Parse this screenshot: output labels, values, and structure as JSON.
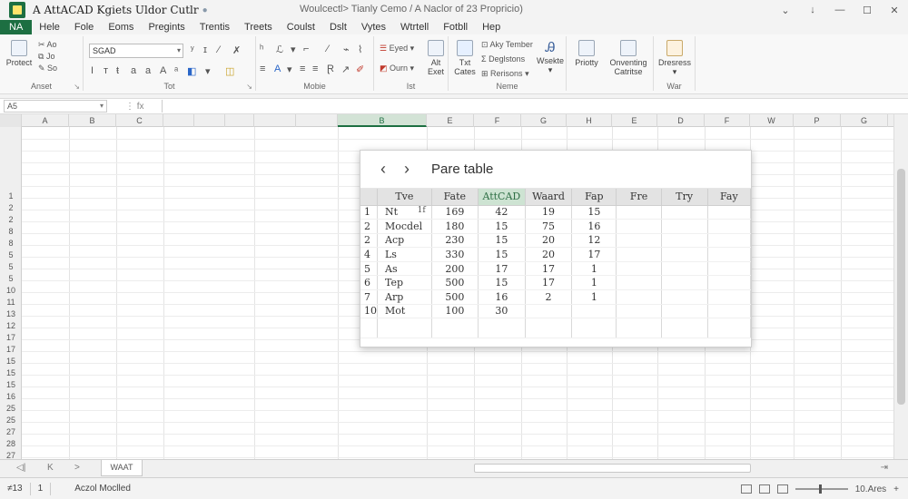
{
  "titlebar": {
    "app_title": "A AttACAD Kgiets Uldor Cutlr",
    "doc_title": "Woulcectl> Tianly Cemo / A Naclor of 23 Propricio)",
    "controls": [
      "⌄",
      "↓",
      "—",
      "☐",
      "✕"
    ]
  },
  "menu": [
    "NA",
    "Hele",
    "Fole",
    "Eoms",
    "Pregints",
    "Trentis",
    "Treets",
    "Coulst",
    "Dslt",
    "Vytes",
    "Wtrtell",
    "Fotbll",
    "Hep"
  ],
  "ribbon": {
    "groups": [
      "Anset",
      "Tot",
      "Mobie",
      "Ist",
      "Neme",
      "War"
    ],
    "clipboard": {
      "paste": "Protect",
      "cut": "Ao",
      "copy": "Jo",
      "paint": "So"
    },
    "font": {
      "name": "SGAD"
    },
    "insert": {
      "save": "Eyed",
      "open": "Ourn",
      "alt_label": "Alt",
      "alt_sub": "Exet"
    },
    "names": {
      "txt": "Txt",
      "txt_sub": "Cates",
      "key_tember": "Aky Tember",
      "designs": "Deglstons",
      "rerisons": "Rerisons"
    },
    "views": {
      "wsekte": "Wsekte",
      "priotty": "Priotty",
      "onventing": "Onventing",
      "catritse": "Catritse",
      "dresress": "Dresress"
    }
  },
  "formula_bar": {
    "name_box": "A5",
    "fx": "fx"
  },
  "columns": [
    "A",
    "B",
    "C",
    "",
    "",
    "",
    "",
    "",
    "B",
    "E",
    "F",
    "G",
    "H",
    "E",
    "D",
    "F",
    "W",
    "P",
    "G"
  ],
  "rows": [
    "1",
    "2",
    "2",
    "8",
    "8",
    "5",
    "5",
    "5",
    "10",
    "11",
    "13",
    "12",
    "17",
    "17",
    "15",
    "15",
    "15",
    "16",
    "25",
    "25",
    "27",
    "28",
    "27"
  ],
  "dialog": {
    "title": "Pare table",
    "headers": [
      "Tve",
      "Fate",
      "AttCAD",
      "Waard",
      "Fap",
      "Fre",
      "Try",
      "Fay"
    ],
    "rows": [
      {
        "idx": "1",
        "name": "Nt",
        "marker": "1f",
        "fate": "169",
        "att": "42",
        "waard": "19",
        "fap": "15"
      },
      {
        "idx": "2",
        "name": "Mocdel",
        "marker": "",
        "fate": "180",
        "att": "15",
        "waard": "75",
        "fap": "16"
      },
      {
        "idx": "2",
        "name": "Acp",
        "marker": "",
        "fate": "230",
        "att": "15",
        "waard": "20",
        "fap": "12"
      },
      {
        "idx": "4",
        "name": "Ls",
        "marker": "",
        "fate": "330",
        "att": "15",
        "waard": "20",
        "fap": "17"
      },
      {
        "idx": "5",
        "name": "As",
        "marker": "",
        "fate": "200",
        "att": "17",
        "waard": "17",
        "fap": "1"
      },
      {
        "idx": "6",
        "name": "Tep",
        "marker": "",
        "fate": "500",
        "att": "15",
        "waard": "17",
        "fap": "1"
      },
      {
        "idx": "7",
        "name": "Arp",
        "marker": "",
        "fate": "500",
        "att": "16",
        "waard": "2",
        "fap": "1"
      },
      {
        "idx": "10",
        "name": "Mot",
        "marker": "",
        "fate": "100",
        "att": "30",
        "waard": "",
        "fap": ""
      }
    ]
  },
  "sheet": {
    "nav_first": "◁|",
    "nav_prev": "K",
    "nav_next": ">",
    "tab": "WAAT"
  },
  "status": {
    "cell_count": "≠13",
    "page": "1",
    "mode": "Aczol Moclled",
    "zoom": "10.Ares"
  }
}
